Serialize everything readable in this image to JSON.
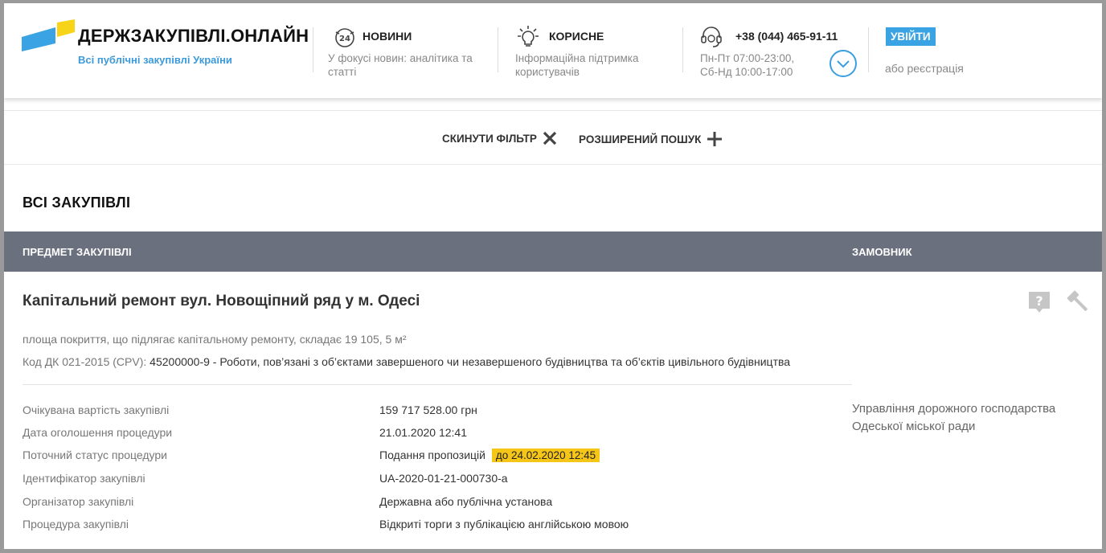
{
  "header": {
    "logo_title": "ДЕРЖЗАКУПІВЛІ.ОНЛАЙН",
    "logo_subtitle": "Всі публічні закупівлі України",
    "news": {
      "title": "НОВИНИ",
      "desc": "У фокусі новин: аналітика та статті",
      "icon": "news-24-icon"
    },
    "useful": {
      "title": "КОРИСНЕ",
      "desc": "Інформаційна підтримка користувачів",
      "icon": "lightbulb-icon"
    },
    "support": {
      "phone": "+38 (044) 465-91-11",
      "hours_weekdays": "Пн-Пт 07:00-23:00,",
      "hours_weekend": "Сб-Нд 10:00-17:00",
      "icon": "headset-icon"
    },
    "login_label": "УВІЙТИ",
    "register_label": "або реєстрація"
  },
  "filters": {
    "reset_label": "СКИНУТИ ФІЛЬТР",
    "advanced_label": "РОЗШИРЕНИЙ ПОШУК"
  },
  "section_title": "ВСІ ЗАКУПІВЛІ",
  "table": {
    "col_subject": "ПРЕДМЕТ ЗАКУПІВЛІ",
    "col_customer": "ЗАМОВНИК"
  },
  "tender": {
    "title": "Капітальний ремонт вул. Новощіпний ряд у м. Одесі",
    "description": "площа покриття, що підлягає капітальному ремонту, складає 19 105, 5 м²",
    "cpv_label": "Код ДК 021-2015 (CPV):",
    "cpv_value": "45200000-9 - Роботи, пов’язані з об’єктами завершеного чи незавершеного будівництва та об’єктів цивільного будівництва",
    "details": [
      {
        "label": "Очікувана вартість закупівлі",
        "value": "159 717 528.00 грн"
      },
      {
        "label": "Дата оголошення процедури",
        "value": "21.01.2020 12:41"
      },
      {
        "label": "Поточний статус процедури",
        "value": "Подання пропозицій"
      },
      {
        "label": "Ідентифікатор закупівлі",
        "value": "UA-2020-01-21-000730-a"
      },
      {
        "label": "Організатор закупівлі",
        "value": "Державна або публічна установа"
      },
      {
        "label": "Процедура закупівлі",
        "value": "Відкриті торги з публікацією англійською мовою"
      }
    ],
    "deadline": "до 24.02.2020 12:45",
    "customer": "Управління дорожного господарства Одеської міської ради"
  },
  "colors": {
    "accent_blue": "#3aa3e3",
    "logo_yellow": "#f7d417",
    "table_header": "#6a707d",
    "deadline_highlight": "#f5c518"
  }
}
